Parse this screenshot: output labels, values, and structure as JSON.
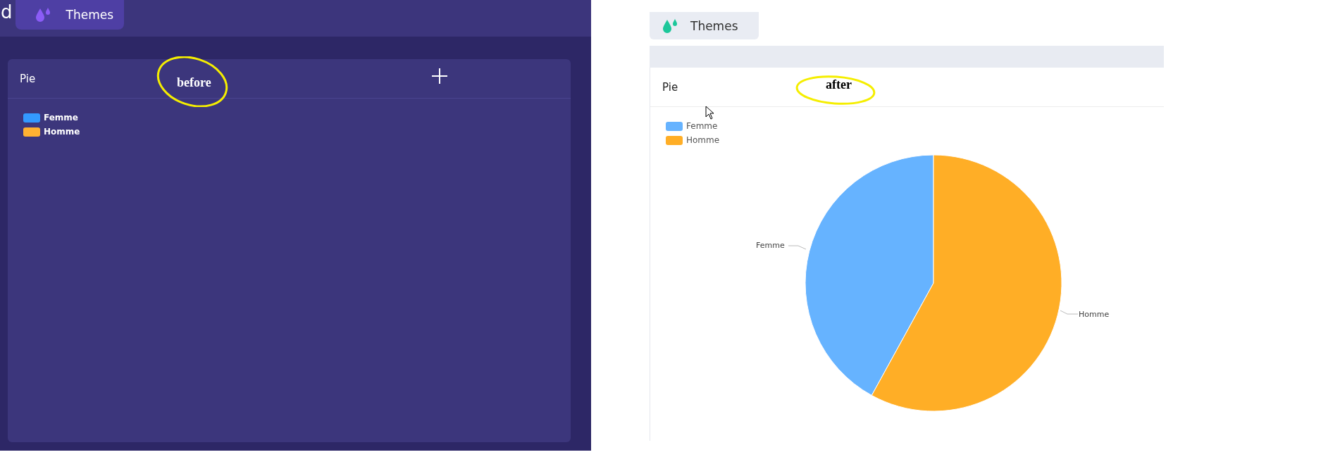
{
  "before": {
    "cut_title": "d",
    "themes_button": "Themes",
    "card": {
      "title": "Pie",
      "legend": [
        {
          "label": "Femme",
          "color": "#3399ff"
        },
        {
          "label": "Homme",
          "color": "#ffb132"
        }
      ]
    },
    "annotation": "before"
  },
  "after": {
    "themes_button": "Themes",
    "card": {
      "title": "Pie",
      "legend": [
        {
          "label": "Femme",
          "color": "#66b3ff"
        },
        {
          "label": "Homme",
          "color": "#ffae26"
        }
      ],
      "slice_labels": [
        "Femme",
        "Homme"
      ]
    },
    "annotation": "after"
  }
}
